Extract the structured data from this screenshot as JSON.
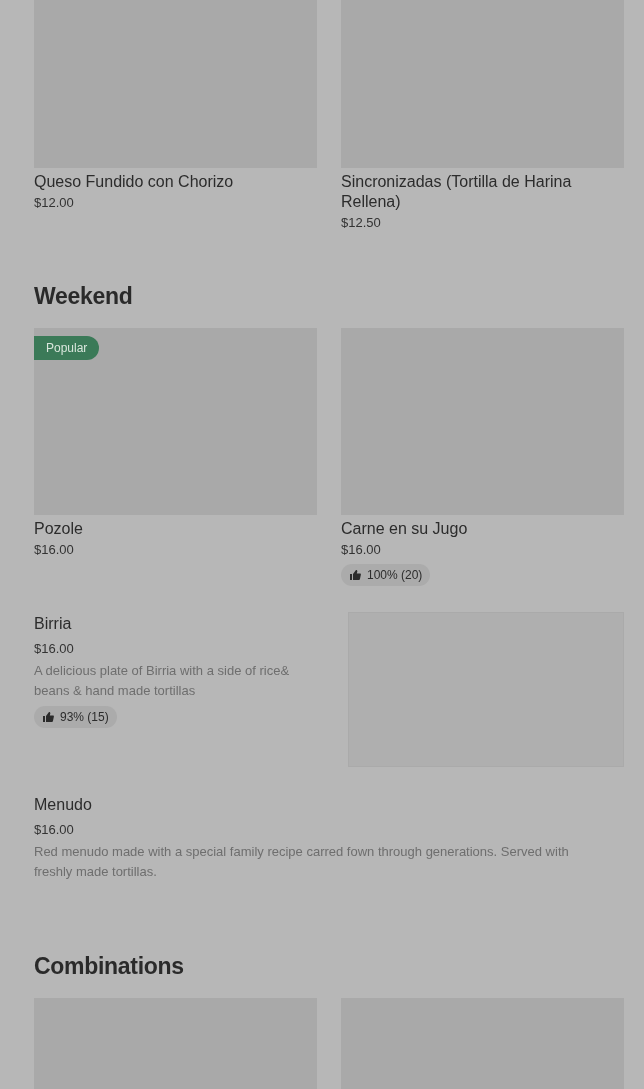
{
  "sections": [
    {
      "items": [
        {
          "kind": "grid",
          "name": "Queso Fundido con Chorizo",
          "price": "$12.00"
        },
        {
          "kind": "grid",
          "name": "Sincronizadas (Tortilla de Harina Rellena)",
          "price": "$12.50"
        }
      ]
    },
    {
      "title": "Weekend",
      "items": [
        {
          "kind": "grid",
          "badge": "Popular",
          "name": "Pozole",
          "price": "$16.00"
        },
        {
          "kind": "grid",
          "name": "Carne en su Jugo",
          "price": "$16.00",
          "rating": "100% (20)"
        },
        {
          "kind": "row",
          "name": "Birria",
          "price": "$16.00",
          "description": "A delicious plate of Birria with a side of rice& beans & hand made tortillas",
          "rating": "93% (15)",
          "image": true
        },
        {
          "kind": "row",
          "name": "Menudo",
          "price": "$16.00",
          "description": "Red menudo made with a special family recipe carred fown through generations. Served with freshly made tortillas.",
          "image": false
        }
      ]
    },
    {
      "title": "Combinations",
      "items": [
        {
          "kind": "grid"
        },
        {
          "kind": "grid"
        }
      ]
    }
  ]
}
